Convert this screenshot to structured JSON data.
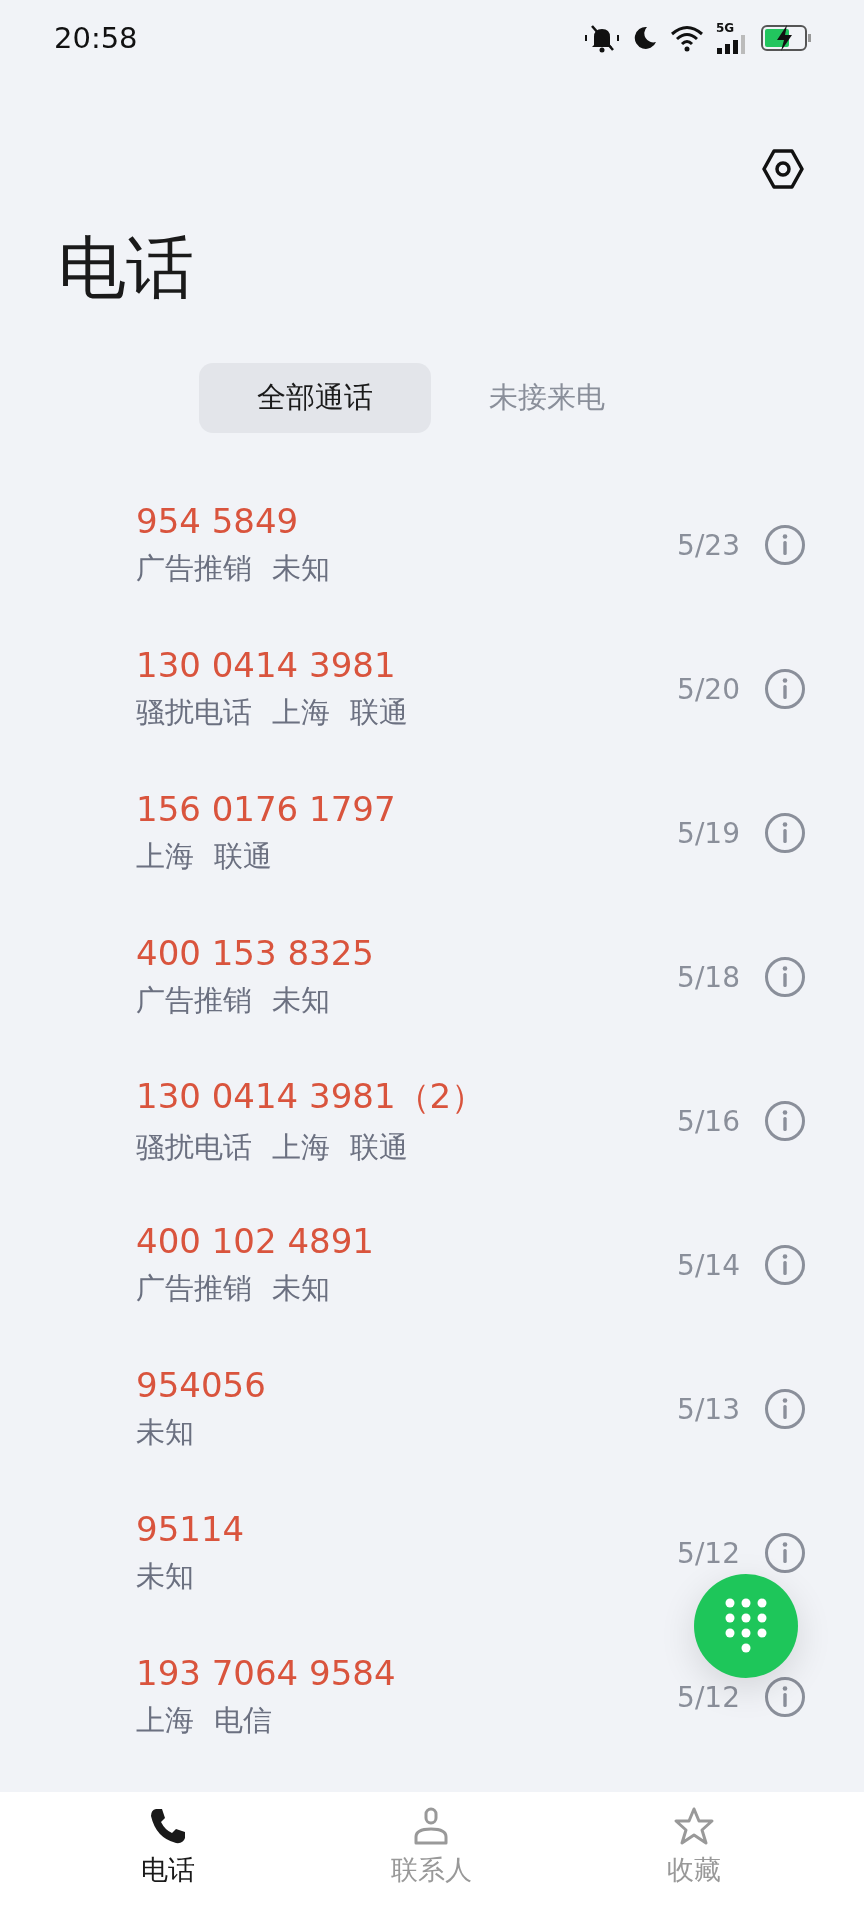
{
  "status_bar": {
    "time": "20:58",
    "network": "5G"
  },
  "title": "电话",
  "tabs": [
    {
      "label": "全部通话",
      "selected": true
    },
    {
      "label": "未接来电",
      "selected": false
    }
  ],
  "calls": [
    {
      "number": "954 5849",
      "tags": [
        "广告推销",
        "未知"
      ],
      "date": "5/23",
      "missed": true
    },
    {
      "number": "130 0414 3981",
      "tags": [
        "骚扰电话",
        "上海",
        "联通"
      ],
      "date": "5/20",
      "missed": true
    },
    {
      "number": "156 0176 1797",
      "tags": [
        "上海",
        "联通"
      ],
      "date": "5/19",
      "missed": true
    },
    {
      "number": "400 153 8325",
      "tags": [
        "广告推销",
        "未知"
      ],
      "date": "5/18",
      "missed": true
    },
    {
      "number": "130 0414 3981（2）",
      "tags": [
        "骚扰电话",
        "上海",
        "联通"
      ],
      "date": "5/16",
      "missed": true
    },
    {
      "number": "400 102 4891",
      "tags": [
        "广告推销",
        "未知"
      ],
      "date": "5/14",
      "missed": true
    },
    {
      "number": "954056",
      "tags": [
        "未知"
      ],
      "date": "5/13",
      "missed": true
    },
    {
      "number": "95114",
      "tags": [
        "未知"
      ],
      "date": "5/12",
      "missed": true
    },
    {
      "number": "193 7064 9584",
      "tags": [
        "上海",
        "电信"
      ],
      "date": "5/12",
      "missed": true
    }
  ],
  "nav": [
    {
      "label": "电话",
      "kind": "phone",
      "selected": true
    },
    {
      "label": "联系人",
      "kind": "contact",
      "selected": false
    },
    {
      "label": "收藏",
      "kind": "star",
      "selected": false
    }
  ]
}
